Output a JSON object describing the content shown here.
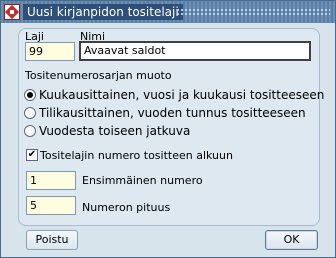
{
  "window": {
    "title": "Uusi kirjanpidon tositelaji"
  },
  "fields": {
    "laji": {
      "label": "Laji",
      "value": "99"
    },
    "nimi": {
      "label": "Nimi",
      "value": "Avaavat saldot"
    }
  },
  "numbering": {
    "group_label": "Tositenumerosarjan muoto",
    "options": [
      {
        "label": "Kuukausittainen, vuosi ja kuukausi tositteeseen",
        "selected": true
      },
      {
        "label": "Tilikausittainen, vuoden tunnus tositteeseen",
        "selected": false
      },
      {
        "label": "Vuodesta toiseen jatkuva",
        "selected": false
      }
    ]
  },
  "checkbox": {
    "label": "Tositelajin numero tositteen alkuun",
    "checked": true
  },
  "first_number": {
    "label": "Ensimmäinen numero",
    "value": "1"
  },
  "number_length": {
    "label": "Numeron pituus",
    "value": "5"
  },
  "buttons": {
    "delete": "Poistu",
    "ok": "OK"
  }
}
